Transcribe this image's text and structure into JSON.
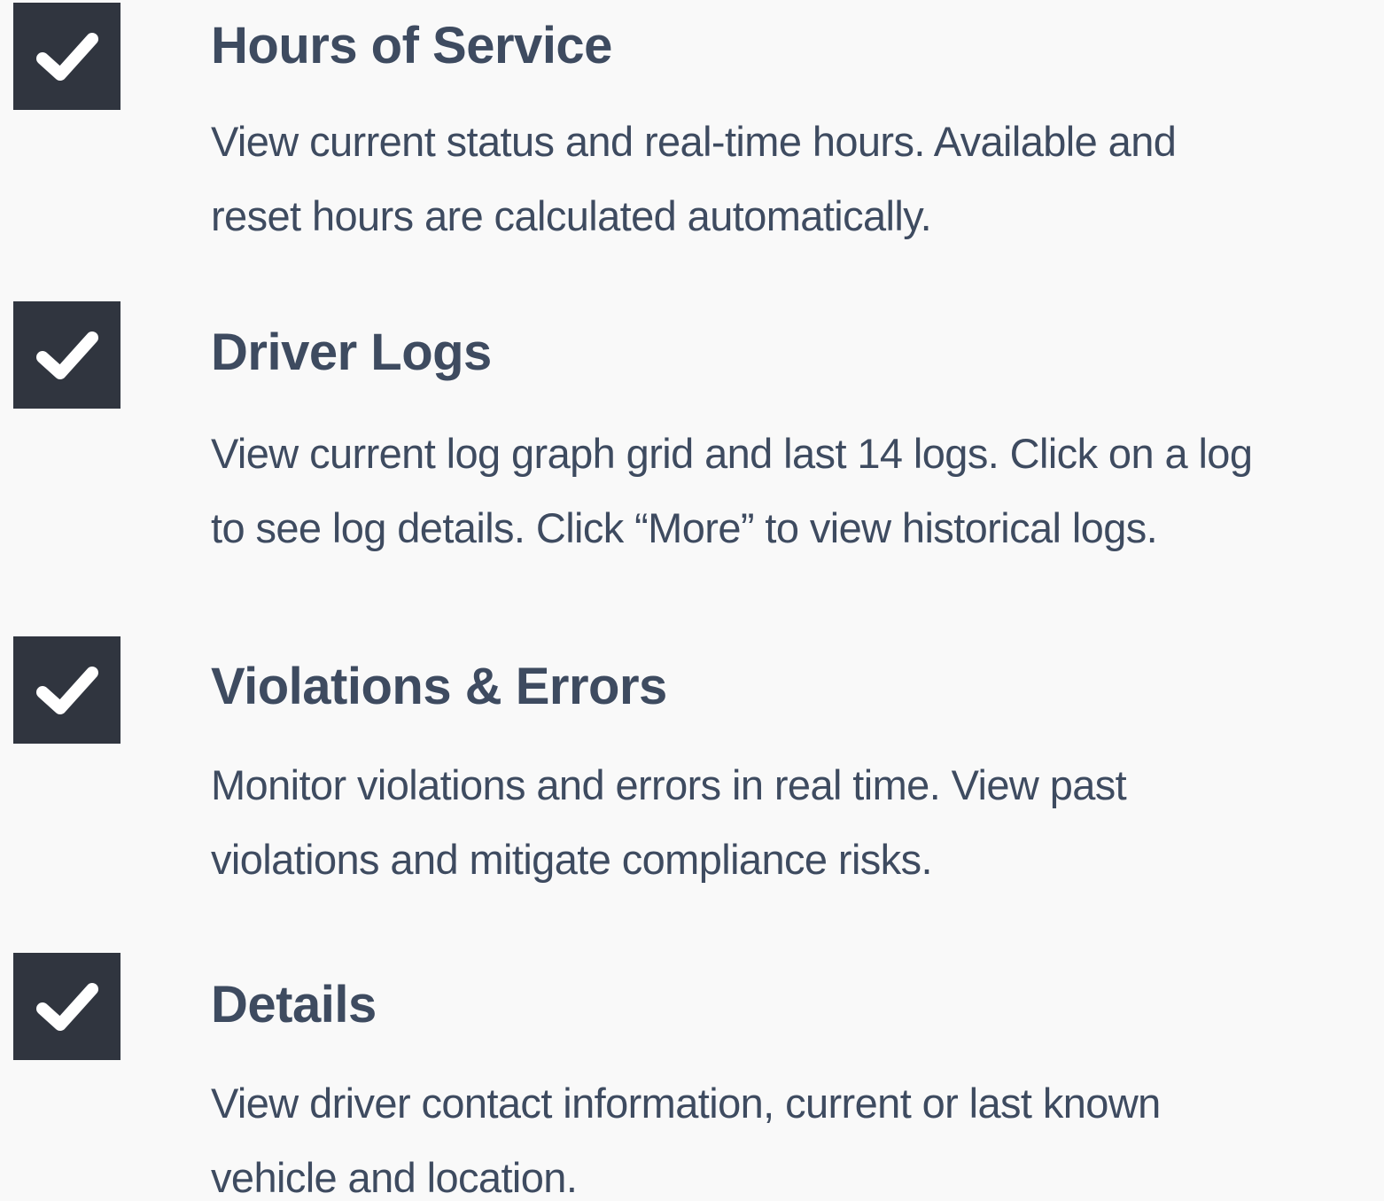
{
  "features": [
    {
      "icon": "checkmark-icon",
      "title": "Hours of Service",
      "description_lines": [
        "View current status and real-time hours. Available and",
        "reset hours are calculated automatically."
      ]
    },
    {
      "icon": "checkmark-icon",
      "title": "Driver Logs",
      "description_lines": [
        "View current log graph grid and last 14 logs. Click on a log",
        "to see log details. Click “More” to view historical logs."
      ]
    },
    {
      "icon": "checkmark-icon",
      "title": "Violations & Errors",
      "description_lines": [
        "Monitor violations and errors in real time. View past",
        "violations and mitigate compliance risks."
      ]
    },
    {
      "icon": "checkmark-icon",
      "title": "Details",
      "description_lines": [
        "View driver contact information, current or last known",
        "vehicle and location."
      ]
    }
  ],
  "colors": {
    "background": "#f9f9f9",
    "checkbox_fill": "#30353f",
    "checkmark": "#ffffff",
    "text": "#3e4b60"
  }
}
